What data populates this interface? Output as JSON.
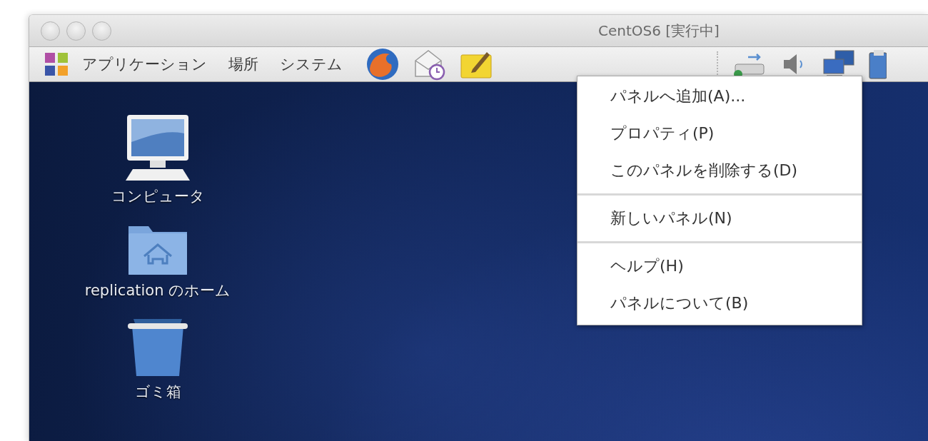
{
  "window": {
    "title": "CentOS6 [実行中]"
  },
  "panel": {
    "menus": [
      {
        "label": "アプリケーション"
      },
      {
        "label": "場所"
      },
      {
        "label": "システム"
      }
    ]
  },
  "desktop_icons": [
    {
      "kind": "computer",
      "label": "コンピュータ"
    },
    {
      "kind": "home",
      "label": "replication のホーム"
    },
    {
      "kind": "trash",
      "label": "ゴミ箱"
    }
  ],
  "context_menu": {
    "sections": [
      {
        "items": [
          {
            "label": "パネルへ追加(A)..."
          },
          {
            "label": "プロパティ(P)"
          },
          {
            "label": "このパネルを削除する(D)"
          }
        ]
      },
      {
        "items": [
          {
            "label": "新しいパネル(N)"
          }
        ]
      },
      {
        "items": [
          {
            "label": "ヘルプ(H)"
          },
          {
            "label": "パネルについて(B)"
          }
        ]
      }
    ]
  }
}
